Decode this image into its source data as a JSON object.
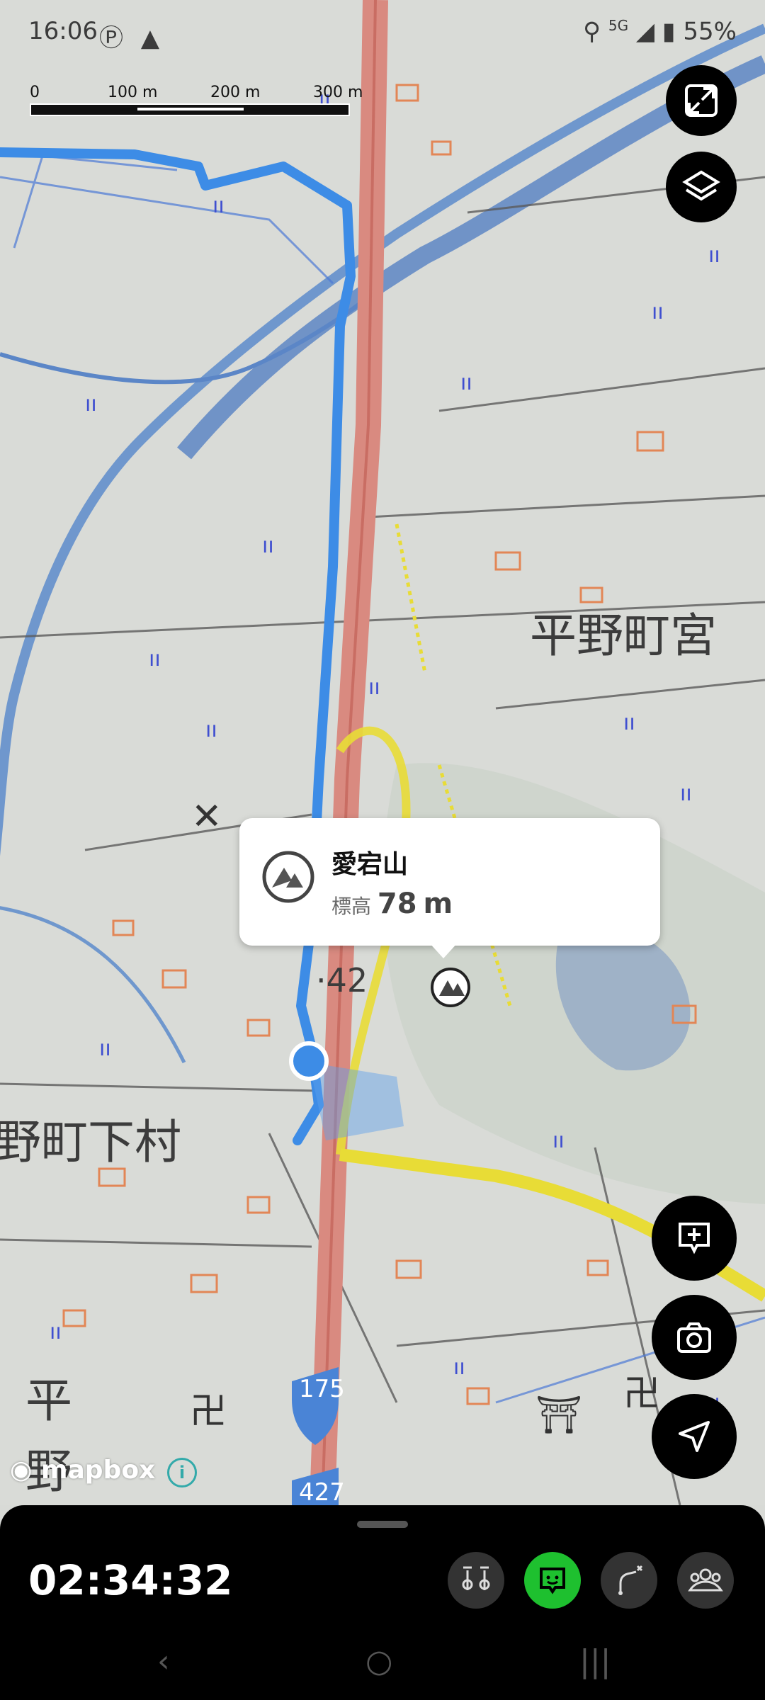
{
  "status": {
    "time": "16:06",
    "network": "5G",
    "battery": "55%"
  },
  "scale": {
    "labels": [
      "0",
      "100 m",
      "200 m",
      "300 m"
    ]
  },
  "map": {
    "place_labels": [
      "平野町宮",
      "野町下村",
      "平",
      "野"
    ],
    "spot_height": "42",
    "route_signs": [
      "175",
      "427"
    ]
  },
  "popup": {
    "name": "愛宕山",
    "elev_label": "標高",
    "elev_value": "78",
    "elev_unit": "m"
  },
  "attribution": {
    "logo": "mapbox",
    "info": "i"
  },
  "tracker": {
    "elapsed": "02:34:32"
  },
  "colors": {
    "track": "#3d8ce6",
    "highway": "#d98a80",
    "active_tool": "#1ec02f"
  }
}
